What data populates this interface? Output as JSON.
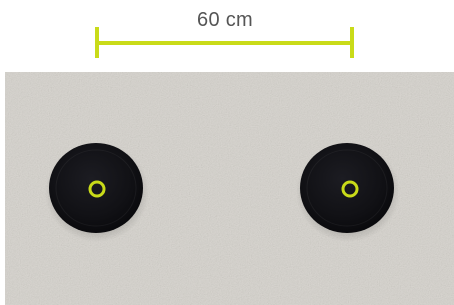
{
  "measurement": {
    "label": "60 cm"
  },
  "colors": {
    "accent": "#c9db19",
    "label_text": "#555555",
    "surface": "#d9d6d1",
    "pad": "#101014"
  },
  "objects": [
    {
      "name": "left-round-pad",
      "icon": "round-black-pad"
    },
    {
      "name": "right-round-pad",
      "icon": "round-black-pad"
    }
  ]
}
